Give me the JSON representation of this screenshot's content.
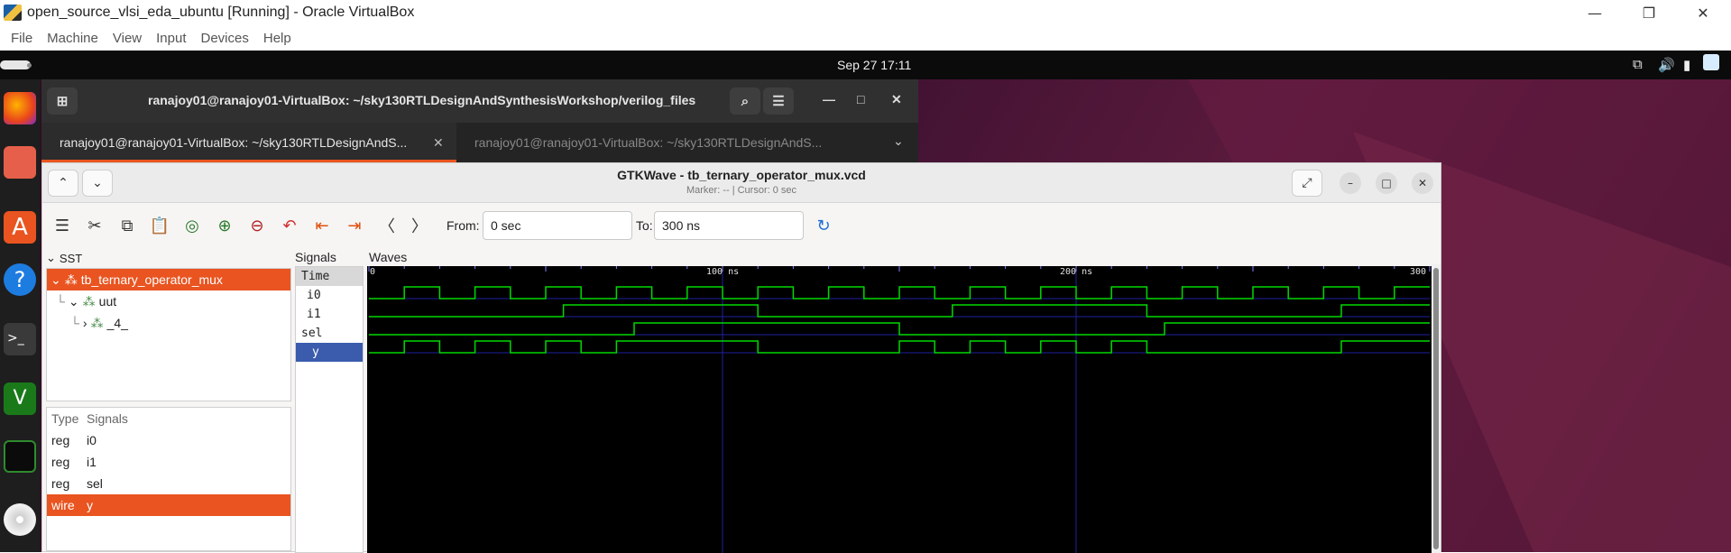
{
  "vbox": {
    "title": "open_source_vlsi_eda_ubuntu [Running] - Oracle VirtualBox",
    "menu": [
      "File",
      "Machine",
      "View",
      "Input",
      "Devices",
      "Help"
    ]
  },
  "topbar": {
    "clock": "Sep 27  17:11"
  },
  "terminal": {
    "title": "ranajoy01@ranajoy01-VirtualBox: ~/sky130RTLDesignAndSynthesisWorkshop/verilog_files",
    "tabs": [
      "ranajoy01@ranajoy01-VirtualBox: ~/sky130RTLDesignAndS...",
      "ranajoy01@ranajoy01-VirtualBox: ~/sky130RTLDesignAndS..."
    ]
  },
  "gtkwave": {
    "title": "GTKWave - tb_ternary_operator_mux.vcd",
    "subtitle": "Marker: --  |  Cursor: 0 sec",
    "from_label": "From:",
    "from_value": "0 sec",
    "to_label": "To:",
    "to_value": "300 ns",
    "sst_label": "SST",
    "tree": {
      "root": "tb_ternary_operator_mux",
      "child": "uut",
      "grandchild": "_4_"
    },
    "type_header": "Type",
    "signals_header": "Signals",
    "signal_list": [
      {
        "type": "reg",
        "name": "i0"
      },
      {
        "type": "reg",
        "name": "i1"
      },
      {
        "type": "reg",
        "name": "sel"
      },
      {
        "type": "wire",
        "name": "y"
      }
    ],
    "signals_pane_label": "Signals",
    "waves_pane_label": "Waves",
    "time_label": "Time",
    "wave_signals": [
      "i0",
      "i1",
      "sel",
      "y"
    ],
    "time_markers": [
      "0",
      "100 ns",
      "200 ns",
      "300"
    ],
    "colors": {
      "accent": "#e95420",
      "wave": "#00d800",
      "grid": "#2020a0",
      "selected_signal": "#3b5cad"
    }
  },
  "waveforms": {
    "time_range_ns": [
      0,
      300
    ],
    "i0_transitions_ns": [
      0,
      10,
      20,
      30,
      40,
      50,
      60,
      70,
      80,
      90,
      100,
      110,
      120,
      130,
      140,
      150,
      160,
      170,
      180,
      190,
      200,
      210,
      220,
      230,
      240,
      250,
      260,
      270,
      280,
      290,
      300
    ],
    "i0_initial": 0,
    "i1_transitions_ns": [
      0,
      55,
      110,
      165,
      220,
      275,
      300
    ],
    "i1_initial": 0,
    "sel_transitions_ns": [
      0,
      75,
      150,
      225,
      300
    ],
    "sel_initial": 0,
    "y_initial": 0
  }
}
